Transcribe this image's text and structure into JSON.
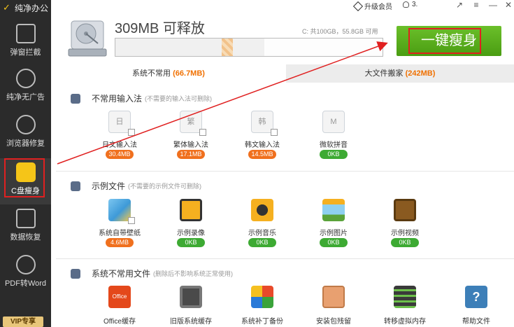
{
  "app": {
    "title": "纯净办公"
  },
  "sidebar": {
    "items": [
      {
        "label": "弹窗拦截"
      },
      {
        "label": "纯净无广告"
      },
      {
        "label": "浏览器修复"
      },
      {
        "label": "C盘瘦身"
      },
      {
        "label": "数据恢复"
      },
      {
        "label": "PDF转Word"
      }
    ],
    "vip_label": "VIP专享"
  },
  "topbar": {
    "upgrade_label": "升级会员",
    "user_label": "3."
  },
  "header": {
    "free_title": "309MB 可释放",
    "capacity_info": "C: 共100GB，55.8GB 可用",
    "slim_button_label": "一键瘦身",
    "usage_fraction": 0.558
  },
  "tabs": [
    {
      "label": "系统不常用",
      "value": "(66.7MB)"
    },
    {
      "label": "大文件搬家",
      "value": "(242MB)"
    }
  ],
  "sections": [
    {
      "title": "不常用输入法",
      "note": "(不需要的输入法可删除)",
      "items": [
        {
          "glyph": "日",
          "name": "日文输入法",
          "size": "30.4MB"
        },
        {
          "glyph": "繁",
          "name": "繁体输入法",
          "size": "17.1MB"
        },
        {
          "glyph": "韩",
          "name": "韩文输入法",
          "size": "14.5MB"
        },
        {
          "glyph": "M",
          "name": "微软拼音",
          "size": "0KB"
        }
      ]
    },
    {
      "title": "示例文件",
      "note": "(不需要的示例文件可删除)",
      "items": [
        {
          "name": "系统自带壁纸",
          "size": "4.6MB"
        },
        {
          "name": "示例录像",
          "size": "0KB"
        },
        {
          "name": "示例音乐",
          "size": "0KB"
        },
        {
          "name": "示例图片",
          "size": "0KB"
        },
        {
          "name": "示例视频",
          "size": "0KB"
        }
      ]
    },
    {
      "title": "系统不常用文件",
      "note": "(删除后不影响系统正常使用)",
      "items": [
        {
          "name": "Office缓存",
          "glyph": "Office"
        },
        {
          "name": "旧版系统缓存"
        },
        {
          "name": "系统补丁备份"
        },
        {
          "name": "安装包残留"
        },
        {
          "name": "转移虚拟内存"
        },
        {
          "name": "帮助文件",
          "glyph": "?"
        }
      ]
    }
  ],
  "colors": {
    "accent_green": "#4a9d12",
    "badge_orange": "#f0701e",
    "badge_green": "#3daa33",
    "highlight_red": "#e02020"
  }
}
